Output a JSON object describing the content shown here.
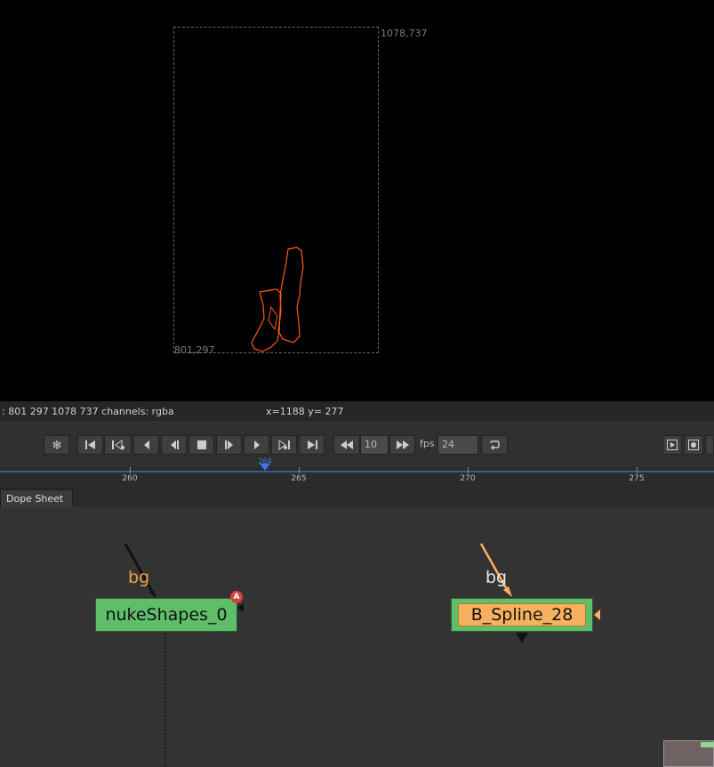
{
  "viewer": {
    "corner_top_right": "1078,737",
    "corner_bottom_left": "801,297",
    "shape_color": "#ff5a1a"
  },
  "info_bar": {
    "format_text": ": 801 297 1078 737 channels: rgba",
    "coords_text": "x=1188 y= 277"
  },
  "transport": {
    "buttons": [
      "freeze-icon",
      "go-to-start-icon",
      "previous-keyframe-icon",
      "step-back-icon",
      "play-backward-icon",
      "stop-icon",
      "play-forward-icon",
      "step-forward-icon",
      "next-keyframe-icon",
      "go-to-end-icon",
      "skip-back-icon",
      "skip-forward-icon",
      "loop-icon"
    ],
    "increment_value": "10",
    "fps_label": "fps",
    "fps_value": "24"
  },
  "timeline": {
    "labels": [
      "260",
      "265",
      "270",
      "275"
    ],
    "current_frame": "264",
    "cursor_color": "#3a7ae0"
  },
  "tabs": {
    "dope_sheet": "Dope Sheet"
  },
  "nodes": {
    "node1_name": "nukeShapes_0",
    "node1_input_label": "bg",
    "node1_badge": "A",
    "node2_name": "B_Spline_28",
    "node2_input_label": "bg",
    "node_color": "#5fbe6a",
    "selected_color": "#f6b15f"
  }
}
